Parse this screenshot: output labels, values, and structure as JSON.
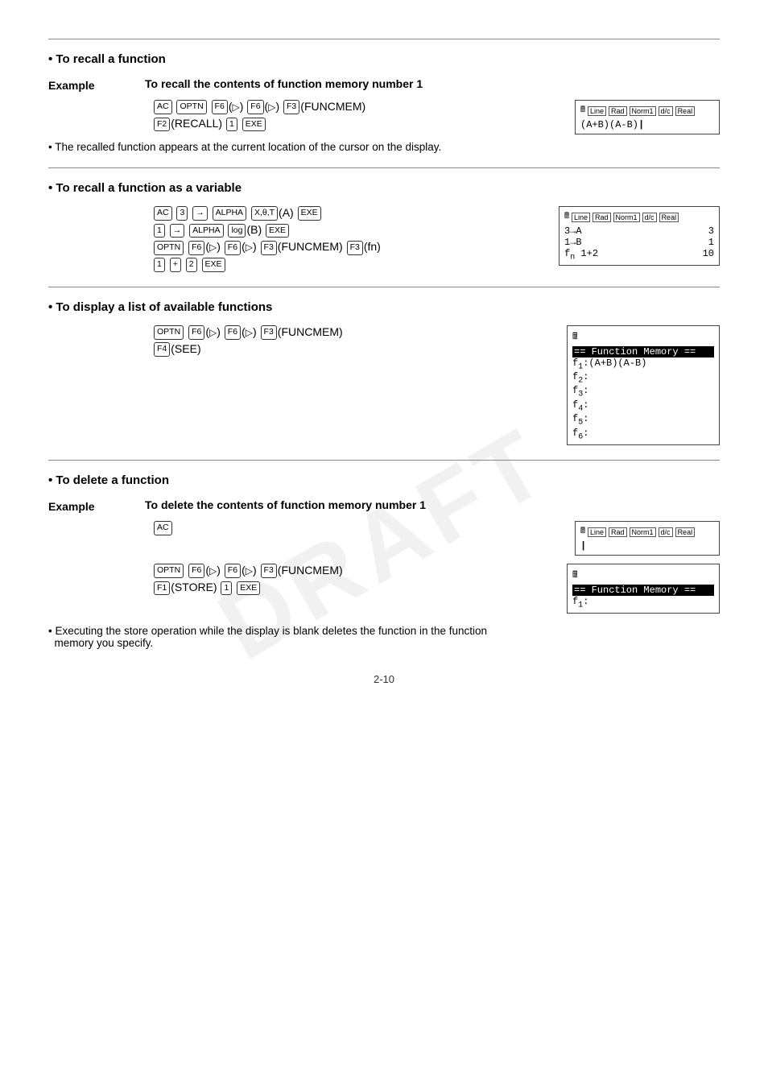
{
  "page": {
    "watermark": "DRAFT",
    "page_number": "2-10",
    "top_rule": true
  },
  "sections": [
    {
      "id": "recall-function",
      "title": "• To recall a function",
      "example": {
        "label": "Example",
        "description": "To recall the contents of function memory number 1"
      },
      "keyseqs": [
        "AC OPTN F6(▷) F6(▷) F3(FUNCMEM)",
        "F2(RECALL) 1 EXE"
      ],
      "screen": {
        "header": [
          "🖩",
          "Line",
          "Rad",
          "Norm1",
          "d/c",
          "Real"
        ],
        "lines": [
          {
            "text": "(A+B)(A-B)",
            "cursor": true,
            "right": ""
          }
        ]
      },
      "note": "• The recalled function appears at the current location of the cursor on the display."
    },
    {
      "id": "recall-as-variable",
      "title": "• To recall a function as a variable",
      "keyseqs": [
        "AC 3 → ALPHA X,θ,T(A) EXE",
        "1 → ALPHA log(B) EXE",
        "OPTN F6(▷) F6(▷) F3(FUNCMEM) F3(fn)",
        "1 + 2 EXE"
      ],
      "screen": {
        "header": [
          "🖩",
          "Line",
          "Rad",
          "Norm1",
          "d/c",
          "Real"
        ],
        "lines": [
          {
            "left": "3→A",
            "right": "3"
          },
          {
            "left": "1→B",
            "right": "1"
          },
          {
            "left": "fn 1+2",
            "right": "10"
          }
        ]
      }
    },
    {
      "id": "display-list",
      "title": "• To display a list of available functions",
      "keyseqs": [
        "OPTN F6(▷) F6(▷) F3(FUNCMEM)",
        "F4(SEE)"
      ],
      "func_mem_screen": {
        "title": "== Function Memory ==",
        "lines": [
          "f1:(A+B)(A-B)",
          "f2:",
          "f3:",
          "f4:",
          "f5:",
          "f6:"
        ],
        "icon": "🖩"
      }
    },
    {
      "id": "delete-function",
      "title": "• To delete a function",
      "example": {
        "label": "Example",
        "description": "To delete the contents of function memory number 1"
      },
      "subsections": [
        {
          "keyseqs": [
            "AC"
          ],
          "screen": {
            "header": [
              "🖩",
              "Line",
              "Rad",
              "Norm1",
              "d/c",
              "Real"
            ],
            "lines": [
              {
                "left": "",
                "right": ""
              }
            ],
            "cursor_only": true
          }
        },
        {
          "keyseqs": [
            "OPTN F6(▷) F6(▷) F3(FUNCMEM)",
            "F1(STORE) 1 EXE"
          ],
          "func_mem_screen": {
            "title": "== Function Memory ==",
            "lines": [
              "f1:"
            ],
            "icon": "🖩"
          }
        }
      ],
      "note": "• Executing the store operation while the display is blank deletes the function in the function\n  memory you specify."
    }
  ]
}
